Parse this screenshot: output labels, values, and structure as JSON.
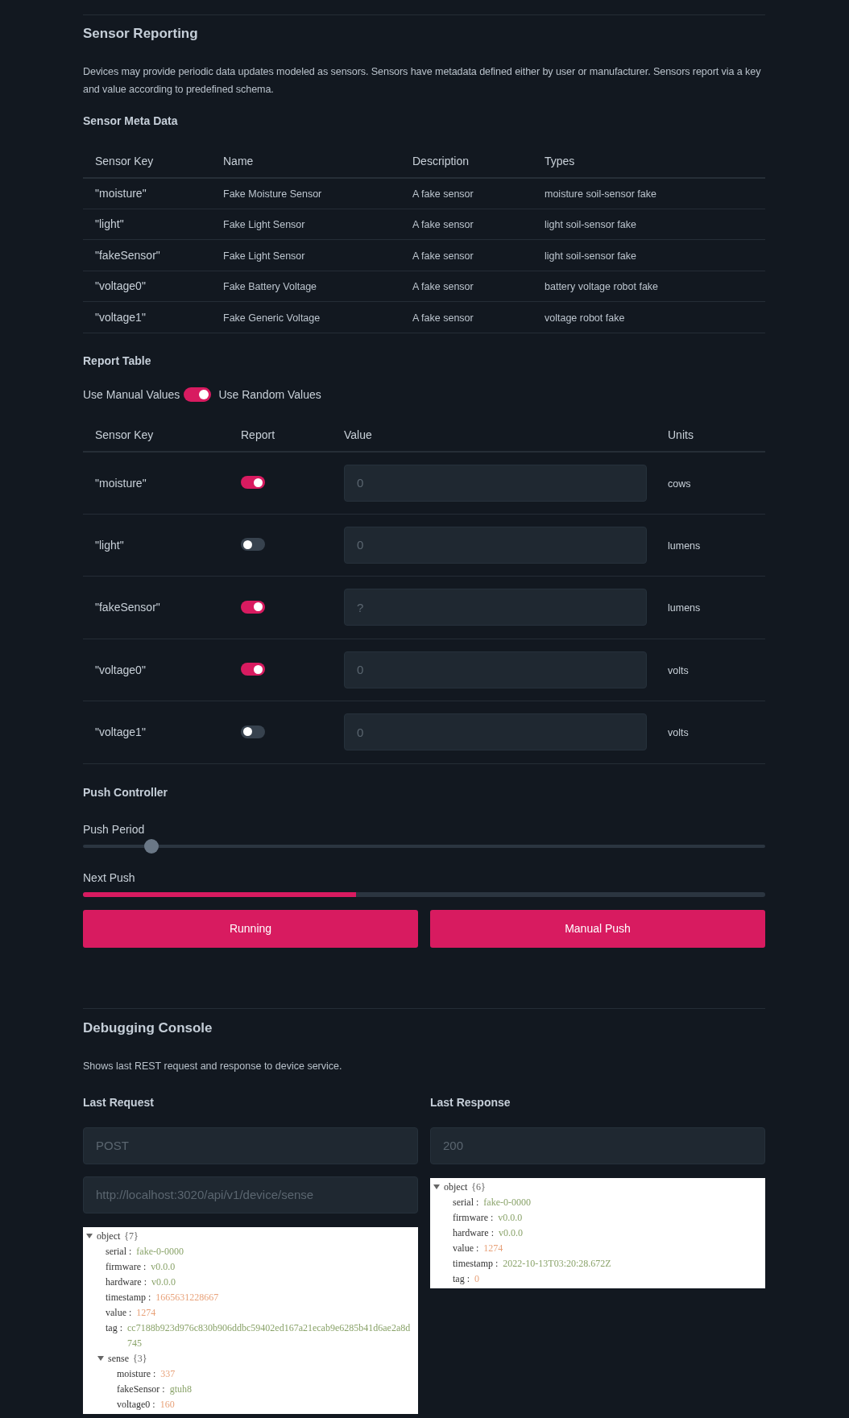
{
  "sensor_reporting": {
    "title": "Sensor Reporting",
    "description": "Devices may provide periodic data updates modeled as sensors. Sensors have metadata defined either by user or manufacturer. Sensors report via a key and value according to predefined schema."
  },
  "meta_table": {
    "title": "Sensor Meta Data",
    "columns": [
      "Sensor Key",
      "Name",
      "Description",
      "Types"
    ],
    "rows": [
      [
        "\"moisture\"",
        "Fake Moisture Sensor",
        "A fake sensor",
        "moisture soil-sensor fake"
      ],
      [
        "\"light\"",
        "Fake Light Sensor",
        "A fake sensor",
        "light soil-sensor fake"
      ],
      [
        "\"fakeSensor\"",
        "Fake Light Sensor",
        "A fake sensor",
        "light soil-sensor fake"
      ],
      [
        "\"voltage0\"",
        "Fake Battery Voltage",
        "A fake sensor",
        "battery voltage robot fake"
      ],
      [
        "\"voltage1\"",
        "Fake Generic Voltage",
        "A fake sensor",
        "voltage robot fake"
      ]
    ]
  },
  "report_table": {
    "title": "Report Table",
    "mode_switch": {
      "left_label": "Use Manual Values",
      "right_label": "Use Random Values",
      "on": true
    },
    "columns": [
      "Sensor Key",
      "Report",
      "Value",
      "Units"
    ],
    "rows": [
      {
        "key": "\"moisture\"",
        "report": true,
        "placeholder": "0",
        "units": "cows"
      },
      {
        "key": "\"light\"",
        "report": false,
        "placeholder": "0",
        "units": "lumens"
      },
      {
        "key": "\"fakeSensor\"",
        "report": true,
        "placeholder": "?",
        "units": "lumens"
      },
      {
        "key": "\"voltage0\"",
        "report": true,
        "placeholder": "0",
        "units": "volts"
      },
      {
        "key": "\"voltage1\"",
        "report": false,
        "placeholder": "0",
        "units": "volts"
      }
    ]
  },
  "push_controller": {
    "title": "Push Controller",
    "period_label": "Push Period",
    "period": {
      "level": 0.1
    },
    "next_label": "Next Push",
    "next": {
      "level": 0.4
    },
    "buttons": [
      "Running",
      "Manual Push"
    ]
  },
  "debugging_console": {
    "title": "Debugging Console",
    "description": "Shows last REST request and response to device service.",
    "request": {
      "title": "Last Request",
      "method_placeholder": "POST",
      "url_placeholder": "http://localhost:3020/api/v1/device/sense",
      "tree": {
        "key": "object",
        "count": "{7}",
        "expanded": true,
        "children": [
          {
            "key": "serial :",
            "value": "fake-0-0000",
            "kind": "string"
          },
          {
            "key": "firmware :",
            "value": "v0.0.0",
            "kind": "string"
          },
          {
            "key": "hardware :",
            "value": "v0.0.0",
            "kind": "string"
          },
          {
            "key": "timestamp :",
            "value": "1665631228667",
            "kind": "number"
          },
          {
            "key": "value :",
            "value": "1274",
            "kind": "number"
          },
          {
            "key": "tag :",
            "value": "cc7188b923d976c830b906ddbc59402ed167a21ecab9e6285b41d6ae2a8d745",
            "kind": "string"
          },
          {
            "key": "sense",
            "count": "{3}",
            "expanded": true,
            "children": [
              {
                "key": "moisture :",
                "value": "337",
                "kind": "number"
              },
              {
                "key": "fakeSensor :",
                "value": "gtuh8",
                "kind": "string"
              },
              {
                "key": "voltage0 :",
                "value": "160",
                "kind": "number"
              }
            ]
          }
        ]
      }
    },
    "response": {
      "title": "Last Response",
      "status_placeholder": "200",
      "tree": {
        "key": "object",
        "count": "{6}",
        "expanded": true,
        "children": [
          {
            "key": "serial :",
            "value": "fake-0-0000",
            "kind": "string"
          },
          {
            "key": "firmware :",
            "value": "v0.0.0",
            "kind": "string"
          },
          {
            "key": "hardware :",
            "value": "v0.0.0",
            "kind": "string"
          },
          {
            "key": "value :",
            "value": "1274",
            "kind": "number"
          },
          {
            "key": "timestamp :",
            "value": "2022-10-13T03:20:28.672Z",
            "kind": "string"
          },
          {
            "key": "tag :",
            "value": "0",
            "kind": "number"
          }
        ]
      }
    }
  }
}
